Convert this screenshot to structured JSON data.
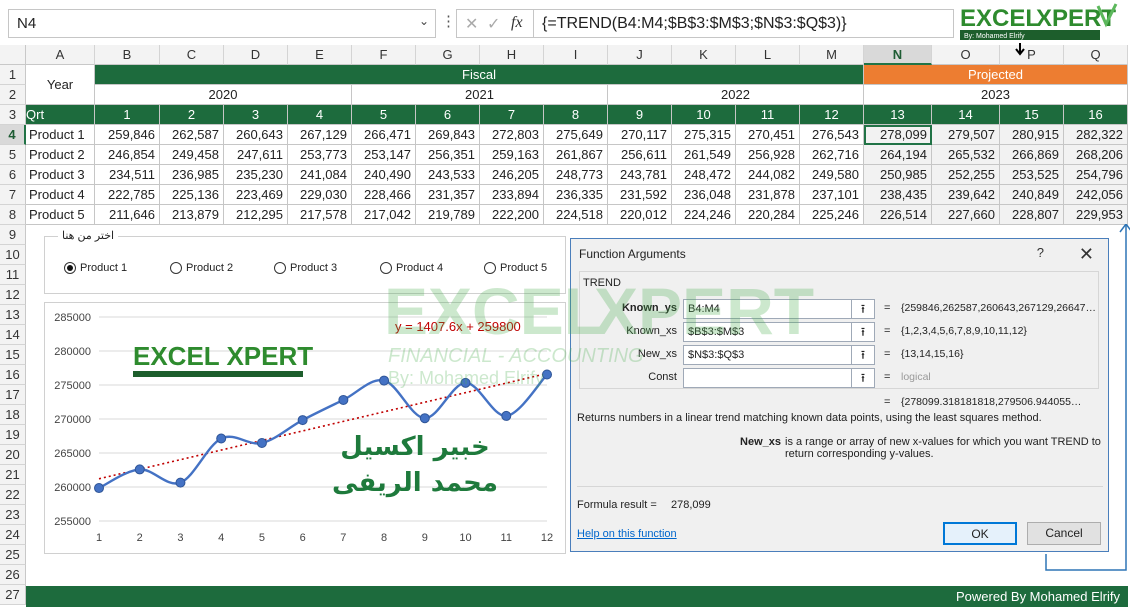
{
  "formula_bar": {
    "name_box": "N4",
    "formula": "{=TREND(B4:M4;$B$3:$M$3;$N$3:$Q$3)}",
    "fx": "fx",
    "cancel": "✕",
    "enter": "✓"
  },
  "columns": [
    "A",
    "B",
    "C",
    "D",
    "E",
    "F",
    "G",
    "H",
    "I",
    "J",
    "K",
    "L",
    "M",
    "N",
    "O",
    "P",
    "Q"
  ],
  "rows": [
    "1",
    "2",
    "3",
    "4",
    "5",
    "6",
    "7",
    "8",
    "9",
    "10",
    "11",
    "12",
    "13",
    "14",
    "15",
    "16",
    "17",
    "18",
    "19",
    "20",
    "21",
    "22",
    "23",
    "24",
    "25",
    "26",
    "27"
  ],
  "table": {
    "year_label": "Year",
    "fiscal": "Fiscal",
    "projected": "Projected",
    "years": [
      "2020",
      "2021",
      "2022",
      "2023"
    ],
    "qrt_label": "Qrt",
    "qrts": [
      "1",
      "2",
      "3",
      "4",
      "5",
      "6",
      "7",
      "8",
      "9",
      "10",
      "11",
      "12",
      "13",
      "14",
      "15",
      "16"
    ],
    "products": [
      {
        "name": "Product 1",
        "values": [
          "259,846",
          "262,587",
          "260,643",
          "267,129",
          "266,471",
          "269,843",
          "272,803",
          "275,649",
          "270,117",
          "275,315",
          "270,451",
          "276,543",
          "278,099",
          "279,507",
          "280,915",
          "282,322"
        ]
      },
      {
        "name": "Product 2",
        "values": [
          "246,854",
          "249,458",
          "247,611",
          "253,773",
          "253,147",
          "256,351",
          "259,163",
          "261,867",
          "256,611",
          "261,549",
          "256,928",
          "262,716",
          "264,194",
          "265,532",
          "266,869",
          "268,206"
        ]
      },
      {
        "name": "Product 3",
        "values": [
          "234,511",
          "236,985",
          "235,230",
          "241,084",
          "240,490",
          "243,533",
          "246,205",
          "248,773",
          "243,781",
          "248,472",
          "244,082",
          "249,580",
          "250,985",
          "252,255",
          "253,525",
          "254,796"
        ]
      },
      {
        "name": "Product 4",
        "values": [
          "222,785",
          "225,136",
          "223,469",
          "229,030",
          "228,466",
          "231,357",
          "233,894",
          "236,335",
          "231,592",
          "236,048",
          "231,878",
          "237,101",
          "238,435",
          "239,642",
          "240,849",
          "242,056"
        ]
      },
      {
        "name": "Product 5",
        "values": [
          "211,646",
          "213,879",
          "212,295",
          "217,578",
          "217,042",
          "219,789",
          "222,200",
          "224,518",
          "220,012",
          "224,246",
          "220,284",
          "225,246",
          "226,514",
          "227,660",
          "228,807",
          "229,953"
        ]
      }
    ]
  },
  "radio_group": {
    "legend": "اختر من هنا",
    "options": [
      "Product 1",
      "Product 2",
      "Product 3",
      "Product 4",
      "Product 5"
    ],
    "selected": 0
  },
  "chart_data": {
    "type": "line",
    "x": [
      1,
      2,
      3,
      4,
      5,
      6,
      7,
      8,
      9,
      10,
      11,
      12
    ],
    "series": [
      {
        "values": [
          259846,
          262587,
          260643,
          267129,
          266471,
          269843,
          272803,
          275649,
          270117,
          275315,
          270451,
          276543
        ],
        "color": "#4472c4"
      }
    ],
    "trendline": {
      "equation": "y = 1407.6x + 259800",
      "slope": 1407.6,
      "intercept": 259800,
      "color": "#c00000"
    },
    "ylim": [
      255000,
      285000
    ],
    "yticks": [
      "255000",
      "260000",
      "265000",
      "270000",
      "275000",
      "280000",
      "285000"
    ],
    "xticks": [
      "1",
      "2",
      "3",
      "4",
      "5",
      "6",
      "7",
      "8",
      "9",
      "10",
      "11",
      "12"
    ],
    "grid": true,
    "watermark_lines": [
      "خبير اكسيل",
      "محمد الريفى"
    ]
  },
  "logo": {
    "text1": "EXCEL",
    "text2": "XPERT",
    "sub1": "FINANCIAL - ACCOUNTING",
    "sub2": "By: Mohamed Elrify"
  },
  "dialog": {
    "title": "Function Arguments",
    "help": "?",
    "close": "✕",
    "function_name": "TREND",
    "args": [
      {
        "label": "Known_ys",
        "input": "B4:M4",
        "value": "{259846,262587,260643,267129,26647…",
        "bold": true
      },
      {
        "label": "Known_xs",
        "input": "$B$3:$M$3",
        "value": "{1,2,3,4,5,6,7,8,9,10,11,12}"
      },
      {
        "label": "New_xs",
        "input": "$N$3:$Q$3",
        "value": "{13,14,15,16}"
      },
      {
        "label": "Const",
        "input": "",
        "value": "logical",
        "gray": true
      }
    ],
    "result_value": "{278099.318181818,279506.944055…",
    "description": "Returns numbers in a linear trend matching known data points, using the least squares method.",
    "param_name": "New_xs",
    "param_desc": "is a range or array of new x-values for which you want TREND to return corresponding y-values.",
    "formula_result_label": "Formula result =",
    "formula_result": "278,099",
    "help_link": "Help on this function",
    "ok": "OK",
    "cancel": "Cancel"
  },
  "footer": "Powered By Mohamed Elrify"
}
